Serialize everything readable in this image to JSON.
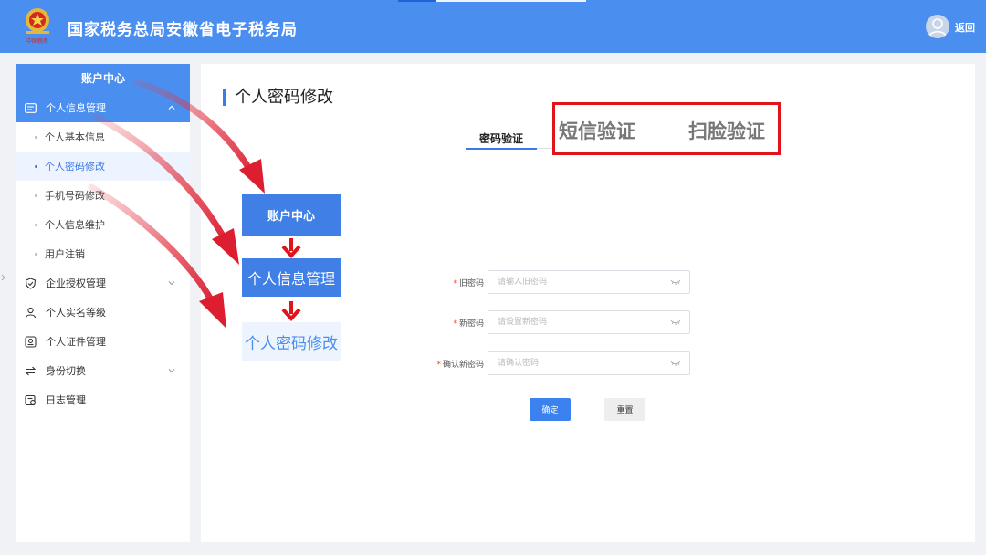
{
  "header": {
    "title": "国家税务总局安徽省电子税务局",
    "back_label": "返回",
    "emblem_text": "中国税务",
    "brand_color": "#4a8ef0"
  },
  "sidebar": {
    "title": "账户中心",
    "menu": [
      {
        "label": "个人信息管理",
        "icon": "id-card-icon",
        "expanded": true,
        "active": true,
        "children": [
          {
            "label": "个人基本信息",
            "active": false
          },
          {
            "label": "个人密码修改",
            "active": true
          },
          {
            "label": "手机号码修改",
            "active": false
          },
          {
            "label": "个人信息维护",
            "active": false
          },
          {
            "label": "用户注销",
            "active": false
          }
        ]
      },
      {
        "label": "企业授权管理",
        "icon": "shield-check-icon",
        "expandable": true
      },
      {
        "label": "个人实名等级",
        "icon": "user-icon"
      },
      {
        "label": "个人证件管理",
        "icon": "badge-icon"
      },
      {
        "label": "身份切换",
        "icon": "switch-icon",
        "expandable": true
      },
      {
        "label": "日志管理",
        "icon": "log-icon"
      }
    ]
  },
  "main": {
    "page_title": "个人密码修改",
    "tabs": [
      {
        "label": "密码验证",
        "active": true
      },
      {
        "label": "短信验证",
        "active": false
      },
      {
        "label": "扫脸验证",
        "active": false
      }
    ],
    "form": {
      "old_password": {
        "label": "旧密码",
        "placeholder": "请输入旧密码",
        "required": true
      },
      "new_password": {
        "label": "新密码",
        "placeholder": "请设置新密码",
        "required": true
      },
      "confirm_password": {
        "label": "确认新密码",
        "placeholder": "请确认密码",
        "required": true
      },
      "required_mark": "*",
      "submit_label": "确定",
      "reset_label": "重置"
    }
  },
  "annotation": {
    "steps": [
      "账户中心",
      "个人信息管理",
      "个人密码修改"
    ],
    "highlight_color": "#e0141b"
  }
}
